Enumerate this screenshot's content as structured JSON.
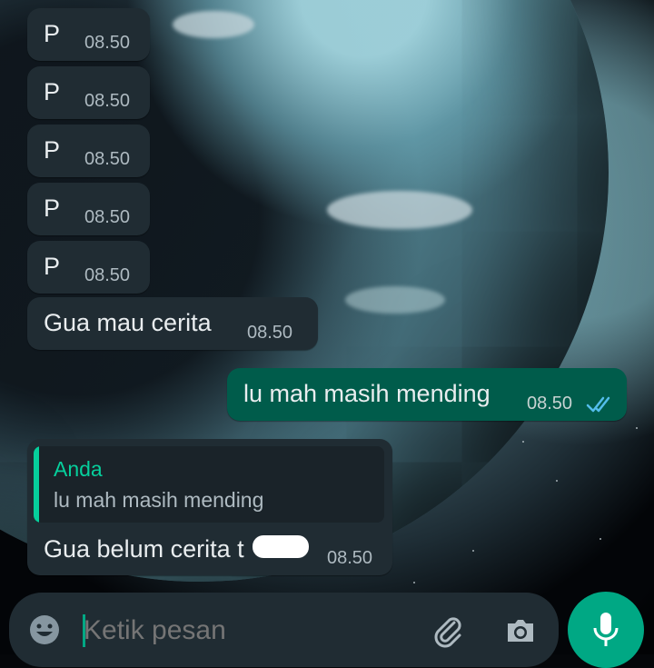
{
  "messages": [
    {
      "text": "P",
      "time": "08.50"
    },
    {
      "text": "P",
      "time": "08.50"
    },
    {
      "text": "P",
      "time": "08.50"
    },
    {
      "text": "P",
      "time": "08.50"
    },
    {
      "text": "P",
      "time": "08.50"
    },
    {
      "text": "Gua mau cerita",
      "time": "08.50"
    }
  ],
  "outgoing": {
    "text": "lu mah masih mending",
    "time": "08.50",
    "status": "read"
  },
  "reply": {
    "quoted_author": "Anda",
    "quoted_text": "lu mah masih mending",
    "text": "Gua belum cerita t",
    "time": "08.50"
  },
  "composer": {
    "placeholder": "Ketik pesan",
    "icons": [
      "emoji-icon",
      "attach-icon",
      "camera-icon",
      "mic-icon"
    ]
  },
  "colors": {
    "incoming_bubble": "#202c33",
    "outgoing_bubble": "#005c4b",
    "accent": "#00a884",
    "read_ticks": "#53bdeb"
  }
}
